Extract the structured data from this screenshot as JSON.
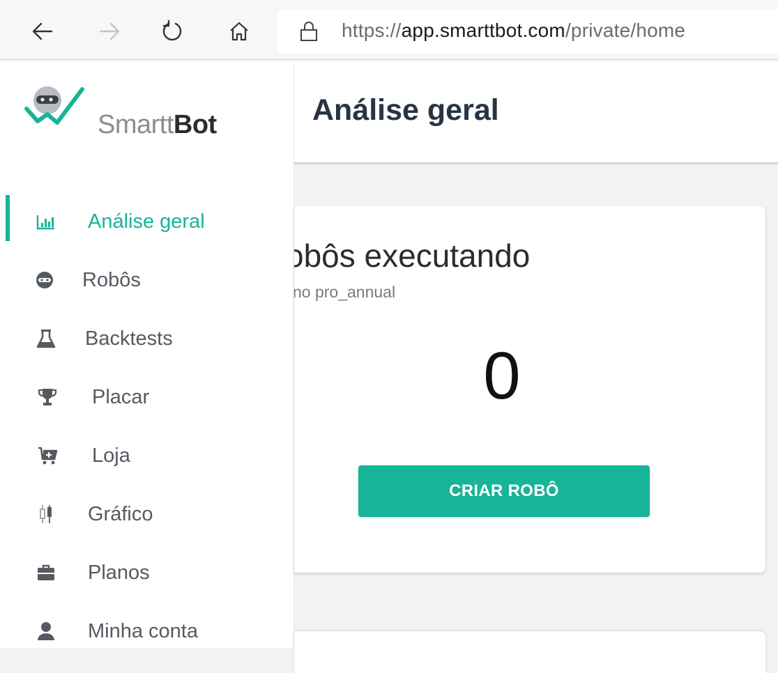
{
  "browser": {
    "url_scheme": "https://",
    "url_host": "app.smarttbot.com",
    "url_path": "/private/home"
  },
  "brand": {
    "name_light": "Smartt",
    "name_bold": "Bot"
  },
  "sidebar": {
    "items": [
      {
        "label": "Análise geral",
        "icon": "bar-chart-icon",
        "active": true
      },
      {
        "label": "Robôs",
        "icon": "robot-icon",
        "active": false
      },
      {
        "label": "Backtests",
        "icon": "flask-icon",
        "active": false
      },
      {
        "label": "Placar",
        "icon": "trophy-icon",
        "active": false
      },
      {
        "label": "Loja",
        "icon": "cart-icon",
        "active": false
      },
      {
        "label": "Gráfico",
        "icon": "candlestick-icon",
        "active": false
      },
      {
        "label": "Planos",
        "icon": "briefcase-icon",
        "active": false
      },
      {
        "label": "Minha conta",
        "icon": "user-icon",
        "active": false
      }
    ]
  },
  "header": {
    "title": "Análise geral"
  },
  "card": {
    "title": "obôs executando",
    "subtitle": "no pro_annual",
    "count": "0",
    "button_label": "CRIAR ROBÔ"
  },
  "colors": {
    "accent": "#17b497",
    "title": "#2a3344",
    "menu_text": "#555a61"
  }
}
